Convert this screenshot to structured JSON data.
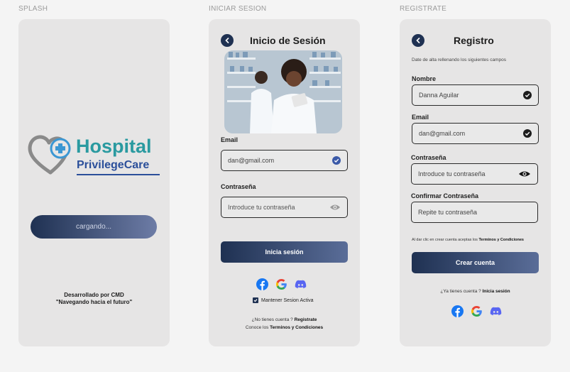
{
  "frames": {
    "splash_label": "SPLASH",
    "login_label": "INICIAR SESION",
    "register_label": "REGISTRATE"
  },
  "splash": {
    "logo_line1": "Hospital",
    "logo_line2": "PrivilegeCare",
    "loading": "cargando...",
    "credits_line1": "Desarrollado por CMD",
    "credits_line2": "\"Navegando hacia el futuro\""
  },
  "login": {
    "title": "Inicio de Sesión",
    "email_label": "Email",
    "email_value": "dan@gmail.com",
    "password_label": "Contraseña",
    "password_placeholder": "Introduce tu contraseña",
    "submit": "Inicia sesión",
    "remember": "Mantener Sesion Activa",
    "no_account": "¿No tienes cuenta ?",
    "register_link": "Registrate",
    "terms_prefix": "Conoce los",
    "terms_link": "Terminos y Condiciones"
  },
  "register": {
    "title": "Registro",
    "subtitle": "Date de alta rellenando los siguientes campos",
    "name_label": "Nombre",
    "name_value": "Danna Aguilar",
    "email_label": "Email",
    "email_value": "dan@gmail.com",
    "password_label": "Contraseña",
    "password_placeholder": "Introduce tu contraseña",
    "confirm_label": "Confirmar Contraseña",
    "confirm_placeholder": "Repite tu contraseña",
    "terms_prefix": "Al dar clic en crear cuenta aceptas los",
    "terms_link": "Terminos y Condiciones",
    "submit": "Crear cuenta",
    "have_account": "¿Ya tienes cuenta ?",
    "login_link": "Inicia sesión"
  },
  "colors": {
    "brand_navy": "#1f3152",
    "brand_teal": "#2a9aa0",
    "brand_blue": "#2b4f9a"
  }
}
